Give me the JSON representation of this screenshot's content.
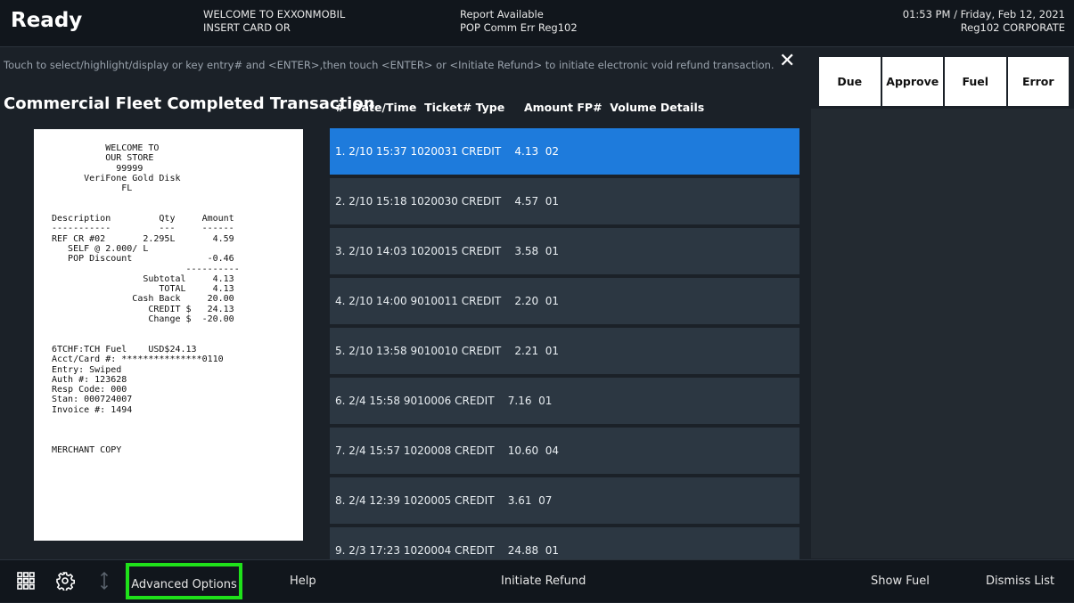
{
  "header": {
    "status": "Ready",
    "message_line1": "WELCOME TO EXXONMOBIL",
    "message_line2": "INSERT CARD OR",
    "report_line1": "Report Available",
    "report_line2": "POP Comm Err Reg102",
    "datetime": "01:53 PM / Friday, Feb 12, 2021",
    "register": "Reg102  CORPORATE"
  },
  "instructions": "Touch to select/highlight/display or key entry# and <ENTER>,then touch <ENTER> or <Initiate Refund> to initiate electronic void refund transaction.",
  "panel_title": "Commercial Fleet Completed Transaction",
  "receipt_text": "          WELCOME TO\n          OUR STORE\n            99999\n      VeriFone Gold Disk\n             FL\n\n\nDescription         Qty     Amount\n-----------         ---     ------\nREF CR #02       2.295L       4.59\n   SELF @ 2.000/ L\n   POP Discount              -0.46\n                         ----------\n                 Subtotal     4.13\n                    TOTAL     4.13\n               Cash Back     20.00\n                  CREDIT $   24.13\n                  Change $  -20.00\n\n\n6TCHF:TCH Fuel    USD$24.13\nAcct/Card #: ***************0110\nEntry: Swiped\nAuth #: 123628\nResp Code: 000\nStan: 000724007\nInvoice #: 1494\n\n\n\nMERCHANT COPY",
  "columns": {
    "num": "#",
    "datetime": "Date/Time",
    "ticket": "Ticket#",
    "type": "Type",
    "amount": "Amount",
    "fp": "FP#",
    "volume": "Volume",
    "details": "Details"
  },
  "transactions": [
    {
      "num": "1.",
      "datetime": "2/10 15:37",
      "ticket": "1020031",
      "type": "CREDIT",
      "amount": "4.13",
      "fp": "02"
    },
    {
      "num": "2.",
      "datetime": "2/10 15:18",
      "ticket": "1020030",
      "type": "CREDIT",
      "amount": "4.57",
      "fp": "01"
    },
    {
      "num": "3.",
      "datetime": "2/10 14:03",
      "ticket": "1020015",
      "type": "CREDIT",
      "amount": "3.58",
      "fp": "01"
    },
    {
      "num": "4.",
      "datetime": "2/10 14:00",
      "ticket": "9010011",
      "type": "CREDIT",
      "amount": "2.20",
      "fp": "01"
    },
    {
      "num": "5.",
      "datetime": "2/10 13:58",
      "ticket": "9010010",
      "type": "CREDIT",
      "amount": "2.21",
      "fp": "01"
    },
    {
      "num": "6.",
      "datetime": "2/4 15:58",
      "ticket": "9010006",
      "type": "CREDIT",
      "amount": "7.16",
      "fp": "01"
    },
    {
      "num": "7.",
      "datetime": "2/4 15:57",
      "ticket": "1020008",
      "type": "CREDIT",
      "amount": "10.60",
      "fp": "04"
    },
    {
      "num": "8.",
      "datetime": "2/4 12:39",
      "ticket": "1020005",
      "type": "CREDIT",
      "amount": "3.61",
      "fp": "07"
    },
    {
      "num": "9.",
      "datetime": "2/3 17:23",
      "ticket": "1020004",
      "type": "CREDIT",
      "amount": "24.88",
      "fp": "01"
    }
  ],
  "filter_tabs": [
    "Due",
    "Approve",
    "Fuel",
    "Error"
  ],
  "bottom_bar": {
    "advanced_options": "Advanced Options",
    "help": "Help",
    "initiate_refund": "Initiate Refund",
    "show_fuel": "Show Fuel",
    "dismiss_list": "Dismiss List"
  },
  "icons": [
    "apps-grid-icon",
    "gear-icon",
    "sort-arrows-icon",
    "close-icon"
  ],
  "colors": {
    "selected_row": "#1e7bdc",
    "row": "#2c3742",
    "highlight_border": "#1fe21a"
  }
}
